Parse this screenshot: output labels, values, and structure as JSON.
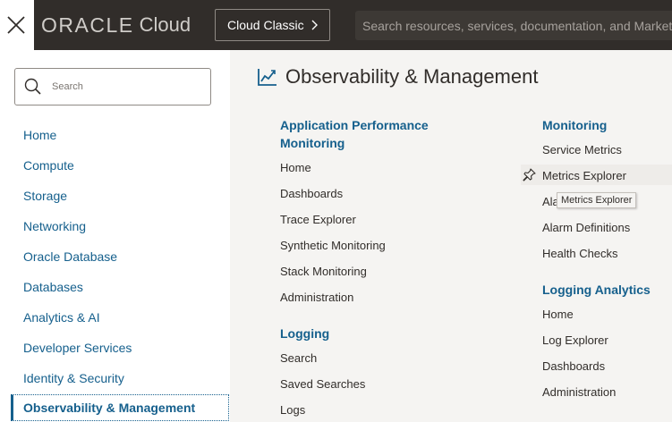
{
  "header": {
    "logo_brand": "ORACLE",
    "logo_product": "Cloud",
    "classic_button": "Cloud Classic",
    "search_placeholder": "Search resources, services, documentation, and Marketplace"
  },
  "left_nav": {
    "search_placeholder": "Search",
    "items": [
      "Home",
      "Compute",
      "Storage",
      "Networking",
      "Oracle Database",
      "Databases",
      "Analytics & AI",
      "Developer Services",
      "Identity & Security",
      "Observability & Management"
    ],
    "selected_index": 9
  },
  "main": {
    "title": "Observability & Management",
    "columns": [
      {
        "sections": [
          {
            "heading_lines": [
              "Application Performance",
              "Monitoring"
            ],
            "links": [
              "Home",
              "Dashboards",
              "Trace Explorer",
              "Synthetic Monitoring",
              "Stack Monitoring",
              "Administration"
            ]
          },
          {
            "heading_lines": [
              "Logging"
            ],
            "links": [
              "Search",
              "Saved Searches",
              "Logs"
            ]
          }
        ]
      },
      {
        "sections": [
          {
            "heading_lines": [
              "Monitoring"
            ],
            "links": [
              "Service Metrics",
              "Metrics Explorer",
              "Ala",
              "Alarm Definitions",
              "Health Checks"
            ]
          },
          {
            "heading_lines": [
              "Logging Analytics"
            ],
            "links": [
              "Home",
              "Log Explorer",
              "Dashboards",
              "Administration"
            ]
          }
        ]
      }
    ],
    "tooltip": "Metrics Explorer"
  },
  "colors": {
    "topbar": "#312d2a",
    "link_blue": "#16608d",
    "text": "#312d2a",
    "panel_bg": "#f5f4f2"
  }
}
